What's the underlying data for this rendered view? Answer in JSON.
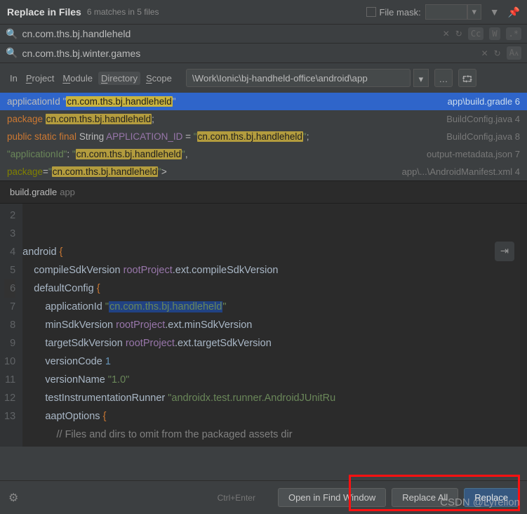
{
  "header": {
    "title": "Replace in Files",
    "subtitle": "6 matches in 5 files",
    "file_mask_label": "File mask:"
  },
  "search": {
    "find_value": "cn.com.ths.bj.handleheld",
    "replace_value": "cn.com.ths.bj.winter.games",
    "cc": "Cc",
    "w": "W",
    "regex": ".*",
    "aa": "Aᴀ"
  },
  "scope": {
    "in": "In",
    "project": "Project",
    "module": "Module",
    "directory": "Directory",
    "scope": "Scope",
    "path": "\\Work\\Ionic\\bj-handheld-office\\android\\app"
  },
  "results": [
    {
      "pre": "applicationId \"",
      "match": "cn.com.ths.bj.handleheld",
      "post": "\"",
      "file": "app\\build.gradle",
      "line": "6",
      "selected": true,
      "style": "gradle"
    },
    {
      "pre": "package ",
      "match": "cn.com.ths.bj.handleheld",
      "post": ";",
      "file": "BuildConfig.java",
      "line": "4",
      "style": "java-pkg"
    },
    {
      "pre_kw": "public static final",
      "pre_type": " String ",
      "pre_var": "APPLICATION_ID",
      "pre_eq": " = \"",
      "match": "cn.com.ths.bj.handleheld",
      "post": "\";",
      "file": "BuildConfig.java",
      "line": "8",
      "style": "java-const"
    },
    {
      "pre": "\"applicationId\": \"",
      "match": "cn.com.ths.bj.handleheld",
      "post": "\",",
      "file": "output-metadata.json",
      "line": "7",
      "style": "json"
    },
    {
      "pre": "package=\"",
      "match": "cn.com.ths.bj.handleheld",
      "post": "\">",
      "file": "app\\...\\AndroidManifest.xml",
      "line": "4",
      "style": "xml"
    }
  ],
  "editor": {
    "filename": "build.gradle",
    "module": "app",
    "lines": [
      {
        "n": "2",
        "t": ""
      },
      {
        "n": "3",
        "t": "android {"
      },
      {
        "n": "4",
        "t": "    compileSdkVersion rootProject.ext.compileSdkVersion"
      },
      {
        "n": "5",
        "t": "    defaultConfig {"
      },
      {
        "n": "6",
        "t": "        applicationId \"cn.com.ths.bj.handleheld\"",
        "hl": true
      },
      {
        "n": "7",
        "t": "        minSdkVersion rootProject.ext.minSdkVersion"
      },
      {
        "n": "8",
        "t": "        targetSdkVersion rootProject.ext.targetSdkVersion"
      },
      {
        "n": "9",
        "t": "        versionCode 1"
      },
      {
        "n": "10",
        "t": "        versionName \"1.0\""
      },
      {
        "n": "11",
        "t": "        testInstrumentationRunner \"androidx.test.runner.AndroidJUnitRu"
      },
      {
        "n": "12",
        "t": "        aaptOptions {"
      },
      {
        "n": "13",
        "t": "            // Files and dirs to omit from the packaged assets dir"
      }
    ]
  },
  "footer": {
    "hint": "Ctrl+Enter",
    "open": "Open in Find Window",
    "replace_all": "Replace All",
    "replace": "Replace"
  },
  "watermark": "CSDN @Lyrelion"
}
